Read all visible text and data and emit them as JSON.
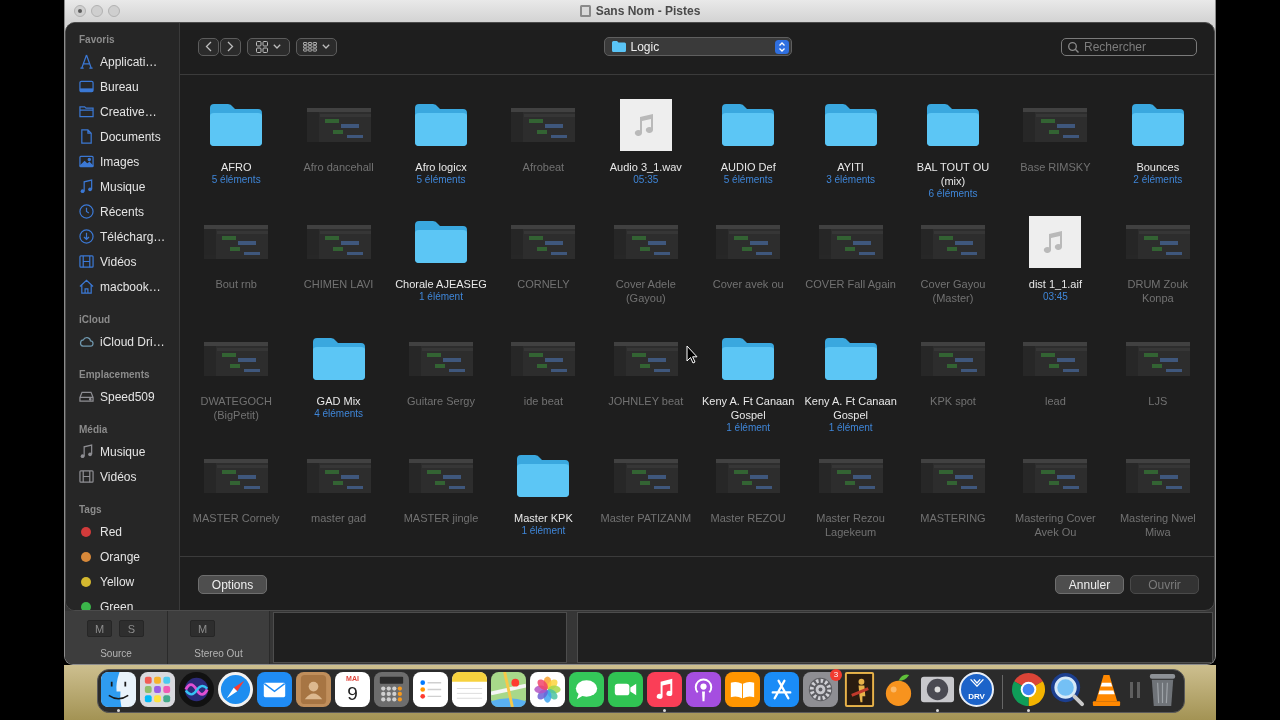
{
  "window": {
    "title": "Sans Nom - Pistes"
  },
  "sidebar": {
    "sections": [
      {
        "heading": "Favoris",
        "kind": "favorites",
        "items": [
          {
            "label": "Applicati…",
            "kind": "applications"
          },
          {
            "label": "Bureau",
            "kind": "desktop"
          },
          {
            "label": "Creative…",
            "kind": "folder"
          },
          {
            "label": "Documents",
            "kind": "documents"
          },
          {
            "label": "Images",
            "kind": "pictures"
          },
          {
            "label": "Musique",
            "kind": "music"
          },
          {
            "label": "Récents",
            "kind": "recents"
          },
          {
            "label": "Télécharg…",
            "kind": "downloads"
          },
          {
            "label": "Vidéos",
            "kind": "movies"
          },
          {
            "label": "macbook…",
            "kind": "home"
          }
        ]
      },
      {
        "heading": "iCloud",
        "kind": "icloud",
        "items": [
          {
            "label": "iCloud Dri…",
            "kind": "icloud"
          }
        ]
      },
      {
        "heading": "Emplacements",
        "kind": "locations",
        "items": [
          {
            "label": "Speed509",
            "kind": "volume"
          }
        ]
      },
      {
        "heading": "Média",
        "kind": "media",
        "items": [
          {
            "label": "Musique",
            "kind": "music"
          },
          {
            "label": "Vidéos",
            "kind": "movies"
          }
        ]
      },
      {
        "heading": "Tags",
        "kind": "tags",
        "items": [
          {
            "label": "Red",
            "kind": "tag",
            "color": "#d23b3b"
          },
          {
            "label": "Orange",
            "kind": "tag",
            "color": "#d8893a"
          },
          {
            "label": "Yellow",
            "kind": "tag",
            "color": "#d4b82f"
          },
          {
            "label": "Green",
            "kind": "tag",
            "color": "#3bb54a"
          }
        ]
      }
    ]
  },
  "toolbar": {
    "location": "Logic",
    "search": {
      "placeholder": "Rechercher"
    }
  },
  "files": [
    {
      "name": "AFRO",
      "kind": "folder",
      "detail": "5 éléments",
      "disabled": false
    },
    {
      "name": "Afro dancehall",
      "kind": "project",
      "disabled": true
    },
    {
      "name": "Afro logicx",
      "kind": "folder",
      "detail": "5 éléments",
      "disabled": false
    },
    {
      "name": "Afrobeat",
      "kind": "project",
      "disabled": true
    },
    {
      "name": "Audio 3_1.wav",
      "kind": "audio",
      "detail": "05:35",
      "disabled": false
    },
    {
      "name": "AUDIO Def",
      "kind": "folder",
      "detail": "5 éléments",
      "disabled": false
    },
    {
      "name": "AYITI",
      "kind": "folder",
      "detail": "3 éléments",
      "disabled": false
    },
    {
      "name": "BAL TOUT OU (mix)",
      "kind": "folder",
      "detail": "6 éléments",
      "disabled": false
    },
    {
      "name": "Base RIMSKY",
      "kind": "project",
      "disabled": true
    },
    {
      "name": "Bounces",
      "kind": "folder",
      "detail": "2 éléments",
      "disabled": false
    },
    {
      "name": "Bout rnb",
      "kind": "project",
      "disabled": true
    },
    {
      "name": "CHIMEN LAVI",
      "kind": "project",
      "disabled": true
    },
    {
      "name": "Chorale AJEASEG",
      "kind": "folder",
      "detail": "1 élément",
      "disabled": false
    },
    {
      "name": "CORNELY",
      "kind": "project",
      "disabled": true
    },
    {
      "name": "Cover Adele (Gayou)",
      "kind": "project",
      "disabled": true
    },
    {
      "name": "Cover avek ou",
      "kind": "project",
      "disabled": true
    },
    {
      "name": "COVER Fall Again",
      "kind": "project",
      "disabled": true
    },
    {
      "name": "Cover Gayou (Master)",
      "kind": "project",
      "disabled": true
    },
    {
      "name": "dist 1_1.aif",
      "kind": "audio",
      "detail": "03:45",
      "disabled": false
    },
    {
      "name": "DRUM Zouk Konpa",
      "kind": "project",
      "disabled": true
    },
    {
      "name": "DWATEGOCH (BigPetit)",
      "kind": "project",
      "disabled": true
    },
    {
      "name": "GAD Mix",
      "kind": "folder",
      "detail": "4 éléments",
      "disabled": false
    },
    {
      "name": "Guitare Sergy",
      "kind": "project",
      "disabled": true
    },
    {
      "name": "ide beat",
      "kind": "project",
      "disabled": true
    },
    {
      "name": "JOHNLEY beat",
      "kind": "project",
      "disabled": true
    },
    {
      "name": "Keny A. Ft Canaan Gospel",
      "kind": "folder",
      "detail": "1 élément",
      "disabled": false
    },
    {
      "name": "Keny A. Ft Canaan Gospel",
      "kind": "folder",
      "detail": "1 élément",
      "disabled": false
    },
    {
      "name": "KPK spot",
      "kind": "project",
      "disabled": true
    },
    {
      "name": "lead",
      "kind": "project",
      "disabled": true
    },
    {
      "name": "LJS",
      "kind": "project",
      "disabled": true
    },
    {
      "name": "MASTER Cornely",
      "kind": "project",
      "disabled": true
    },
    {
      "name": "master gad",
      "kind": "project",
      "disabled": true
    },
    {
      "name": "MASTER jingle",
      "kind": "project",
      "disabled": true
    },
    {
      "name": "Master KPK",
      "kind": "folder",
      "detail": "1 élément",
      "disabled": false
    },
    {
      "name": "Master PATIZANM",
      "kind": "project",
      "disabled": true
    },
    {
      "name": "Master REZOU",
      "kind": "project",
      "disabled": true
    },
    {
      "name": "Master Rezou Lagekeum",
      "kind": "project",
      "disabled": true
    },
    {
      "name": "MASTERING",
      "kind": "project",
      "disabled": true
    },
    {
      "name": "Mastering Cover Avek Ou",
      "kind": "project",
      "disabled": true
    },
    {
      "name": "Mastering Nwel Miwa",
      "kind": "project",
      "disabled": true
    }
  ],
  "footer": {
    "left_buttons": [
      {
        "label": "Options",
        "disabled": false
      }
    ],
    "right_buttons": [
      {
        "label": "Annuler",
        "disabled": false
      },
      {
        "label": "Ouvrir",
        "disabled": true
      }
    ]
  },
  "mixer": {
    "strips": [
      {
        "name": "Source",
        "buttons": [
          "M",
          "S"
        ]
      },
      {
        "name": "Stereo Out",
        "buttons": [
          "M"
        ]
      }
    ]
  },
  "dock": {
    "apps": [
      {
        "kind": "face",
        "running": true
      },
      {
        "kind": "grid",
        "running": false
      },
      {
        "kind": "orb",
        "running": false
      },
      {
        "kind": "compass",
        "running": false
      },
      {
        "kind": "envelope",
        "running": false
      },
      {
        "kind": "address-book",
        "running": false
      },
      {
        "kind": "calendar",
        "running": false,
        "month": "MAI",
        "day": "9"
      },
      {
        "kind": "calculator",
        "running": false
      },
      {
        "kind": "checklist",
        "running": false
      },
      {
        "kind": "notepad",
        "running": false
      },
      {
        "kind": "map",
        "running": false
      },
      {
        "kind": "flower",
        "running": false
      },
      {
        "kind": "chat",
        "running": false
      },
      {
        "kind": "video-camera",
        "running": false
      },
      {
        "kind": "music-note",
        "running": true
      },
      {
        "kind": "podcast",
        "running": false
      },
      {
        "kind": "book",
        "running": false
      },
      {
        "kind": "a-shape",
        "running": false
      },
      {
        "kind": "gear",
        "running": false,
        "badge": "3"
      },
      {
        "kind": "guitarist-poster",
        "running": false
      },
      {
        "kind": "fruit",
        "running": false
      },
      {
        "kind": "disc",
        "running": true
      },
      {
        "kind": "round-logo",
        "running": false,
        "text": "DRV"
      }
    ],
    "others": [
      {
        "kind": "tricolor-circle",
        "running": true
      },
      {
        "kind": "q-lens",
        "running": false
      },
      {
        "kind": "traffic-cone",
        "running": false
      },
      {
        "kind": "pause",
        "running": false
      },
      {
        "kind": "trash",
        "running": false
      }
    ]
  }
}
